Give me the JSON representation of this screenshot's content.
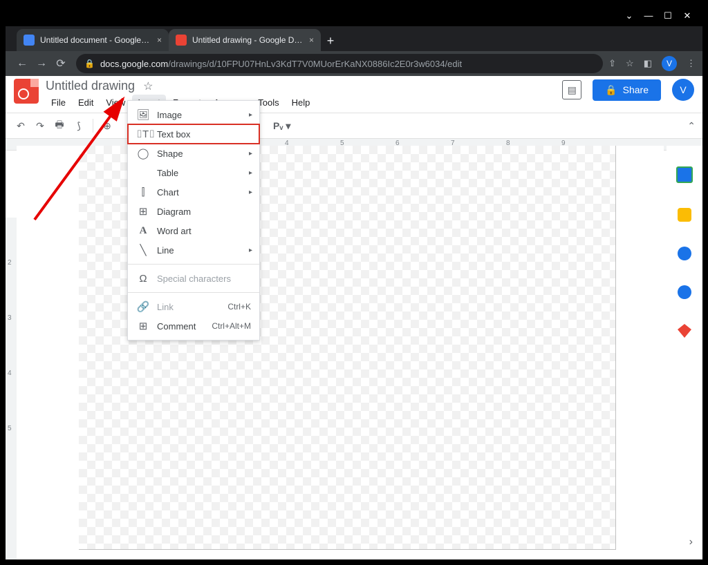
{
  "window_controls": {
    "minimize": "—",
    "maximize": "☐",
    "close": "✕",
    "dropdown": "⌄"
  },
  "tabs": [
    {
      "title": "Untitled document - Google Docs",
      "favicon": "#4285f4"
    },
    {
      "title": "Untitled drawing - Google Drawings",
      "favicon": "#ea4335"
    }
  ],
  "addressbar": {
    "back": "←",
    "forward": "→",
    "reload": "⟳",
    "lock": "🔒",
    "host": "docs.google.com",
    "path": "/drawings/d/10FPU07HnLv3KdT7V0MUorErKaNX0886Ic2E0r3w6034/edit",
    "share": "⇧",
    "star": "☆",
    "ext": "◧",
    "profile": "V",
    "menu": "⋮"
  },
  "doc": {
    "name": "Untitled drawing",
    "star": "☆",
    "share_label": "Share",
    "share_icon": "🔒",
    "comment_icon": "▤",
    "profile": "V"
  },
  "menubar": [
    "File",
    "Edit",
    "View",
    "Insert",
    "Format",
    "Arrange",
    "Tools",
    "Help"
  ],
  "menubar_open": 3,
  "toolbar": {
    "undo": "↶",
    "redo": "↷",
    "print": "🖶",
    "paint": "⟆",
    "zoom": "⊕",
    "fill": "Pᵥ ▾",
    "collapse": "⌃"
  },
  "ruler_top": [
    "4",
    "5",
    "6",
    "7",
    "8",
    "9"
  ],
  "ruler_left": [
    "2",
    "3",
    "4",
    "5"
  ],
  "insert_menu": [
    {
      "icon": "🖼",
      "label": "Image",
      "sub": true
    },
    {
      "icon": "⌷T⌷",
      "label": "Text box",
      "sub": false,
      "highlight": true
    },
    {
      "icon": "◯",
      "label": "Shape",
      "sub": true
    },
    {
      "icon": "",
      "label": "Table",
      "sub": true
    },
    {
      "icon": "⫿",
      "label": "Chart",
      "sub": true
    },
    {
      "icon": "⊞",
      "label": "Diagram"
    },
    {
      "icon": "A",
      "label": "Word art"
    },
    {
      "icon": "╲",
      "label": "Line",
      "sub": true
    },
    {
      "type": "hr"
    },
    {
      "icon": "Ω",
      "label": "Special characters",
      "disabled": true
    },
    {
      "type": "hr"
    },
    {
      "icon": "🔗",
      "label": "Link",
      "shortcut": "Ctrl+K",
      "disabled": true
    },
    {
      "icon": "⊞",
      "label": "Comment",
      "shortcut": "Ctrl+Alt+M"
    }
  ],
  "side_icons": [
    {
      "name": "calendar-icon",
      "color": "#34a853"
    },
    {
      "name": "keep-icon",
      "color": "#fbbc04"
    },
    {
      "name": "tasks-icon",
      "color": "#1a73e8"
    },
    {
      "name": "contacts-icon",
      "color": "#1a73e8"
    },
    {
      "name": "maps-icon",
      "color": "#ea4335"
    }
  ]
}
